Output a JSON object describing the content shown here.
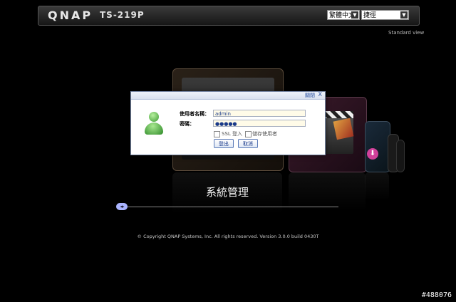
{
  "header": {
    "brand": "QNAP",
    "model": "TS-219P",
    "language_select": "繁體中文",
    "theme_select": "捷徑",
    "standard_view_link": "Standard view"
  },
  "tiles": {
    "main_label": "系統管理"
  },
  "footer": {
    "copyright": "© Copyright QNAP Systems, Inc. All rights reserved. Version 3.0.0 build 0430T"
  },
  "watermark": "#488076",
  "login_dialog": {
    "close_label": "關閉",
    "close_x": "X",
    "username_label": "使用者名稱：",
    "password_label": "密碼：",
    "username_value": "admin",
    "password_value": "●●●●●",
    "ssl_label": "SSL 登入",
    "remember_label": "儲存使用者",
    "login_button": "登出",
    "cancel_button": "取消"
  },
  "colors": {
    "background": "#000000",
    "dialog_border": "#7a8aa8",
    "link_blue": "#2850a0",
    "avatar_green": "#3a9a30"
  },
  "icons": {
    "avatar": "user-avatar-icon",
    "close": "close-icon",
    "download": "download-arrow-icon",
    "scroll": "slider-handle-icon"
  }
}
